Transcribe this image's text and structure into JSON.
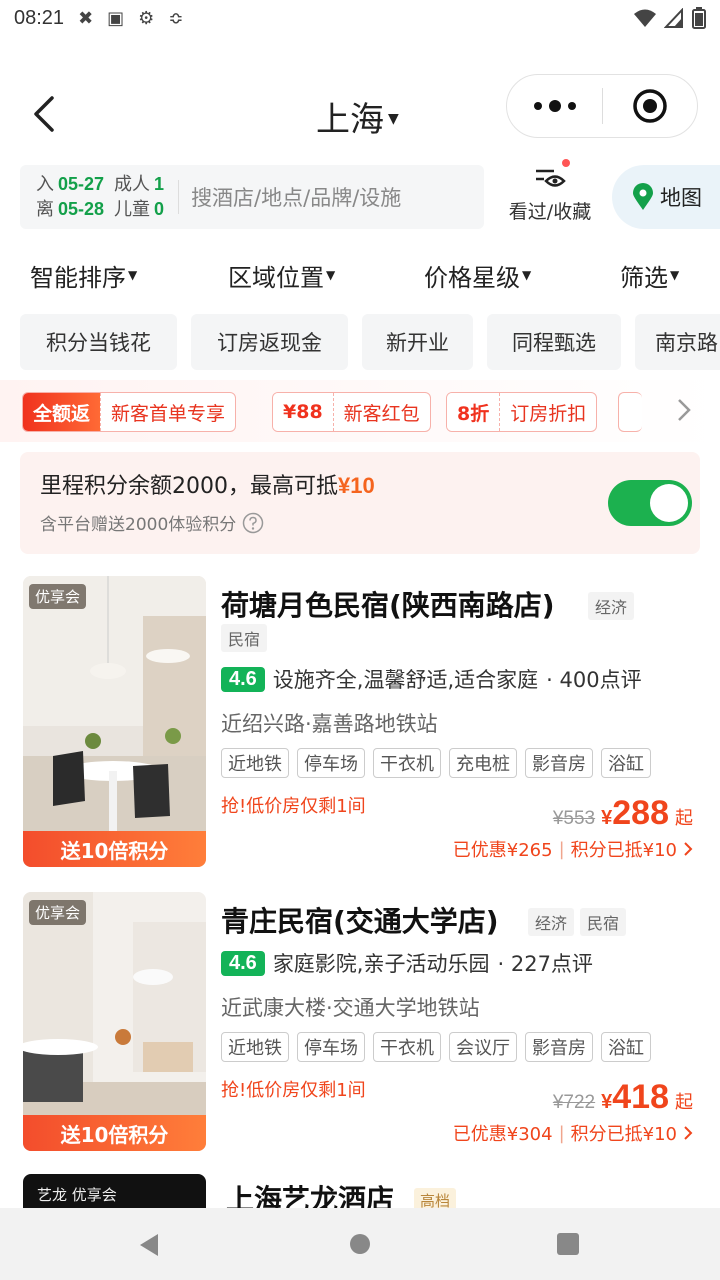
{
  "status_bar": {
    "time": "08:21"
  },
  "header": {
    "city": "上海"
  },
  "search": {
    "checkin_label": "入",
    "checkin_date": "05-27",
    "checkout_label": "离",
    "checkout_date": "05-28",
    "adults_label": "成人",
    "adults_count": "1",
    "children_label": "儿童",
    "children_count": "0",
    "placeholder": "搜酒店/地点/品牌/设施",
    "history_label": "看过/收藏",
    "map_label": "地图"
  },
  "filter_tabs": [
    "智能排序",
    "区域位置",
    "价格星级",
    "筛选"
  ],
  "chips": [
    "积分当钱花",
    "订房返现金",
    "新开业",
    "同程甄选",
    "南京路"
  ],
  "promos": [
    {
      "tag": "全额返",
      "text": "新客首单专享"
    },
    {
      "tag": "¥88",
      "text": "新客红包"
    },
    {
      "tag": "8折",
      "text": "订房折扣"
    }
  ],
  "points": {
    "main_text": "里程积分余额2000，最高可抵",
    "main_amount": "¥10",
    "sub_text": "含平台赠送2000体验积分",
    "toggle_on": true,
    "accent_color": "#1cb14f"
  },
  "hotels": [
    {
      "badge": "优享会",
      "bonus": "送10倍积分",
      "name": "荷塘月色民宿(陕西南路店)",
      "grades": [
        "经济",
        "民宿"
      ],
      "score": "4.6",
      "highlights": "设施齐全,温馨舒适,适合家庭",
      "reviews": "· 400点评",
      "location": "近绍兴路·嘉善路地铁站",
      "amenities": [
        "近地铁",
        "停车场",
        "干衣机",
        "充电桩",
        "影音房",
        "浴缸"
      ],
      "urgent": "抢!低价房仅剩1间",
      "original_price": "¥553",
      "price_symbol": "¥",
      "price": "288",
      "price_suffix": "起",
      "discount": "已优惠¥265",
      "points_discount": "积分已抵¥10"
    },
    {
      "badge": "优享会",
      "bonus": "送10倍积分",
      "name": "青庄民宿(交通大学店)",
      "grades": [
        "经济",
        "民宿"
      ],
      "score": "4.6",
      "highlights": "家庭影院,亲子活动乐园",
      "reviews": "· 227点评",
      "location": "近武康大楼·交通大学地铁站",
      "amenities": [
        "近地铁",
        "停车场",
        "干衣机",
        "会议厅",
        "影音房",
        "浴缸"
      ],
      "urgent": "抢!低价房仅剩1间",
      "original_price": "¥722",
      "price_symbol": "¥",
      "price": "418",
      "price_suffix": "起",
      "discount": "已优惠¥304",
      "points_discount": "积分已抵¥10"
    }
  ],
  "partial_hotel": {
    "badges": "艺龙  优享会",
    "name": "上海艺龙酒店",
    "grade": "高档"
  }
}
